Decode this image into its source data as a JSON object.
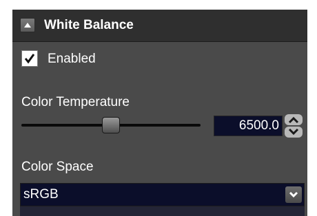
{
  "section": {
    "title": "White Balance",
    "expanded": true
  },
  "enabled": {
    "label": "Enabled",
    "checked": true
  },
  "color_temperature": {
    "label": "Color Temperature",
    "value": "6500.0",
    "slider_fraction": 0.5
  },
  "color_space": {
    "label": "Color Space",
    "selected": "sRGB"
  },
  "colors": {
    "panel_bg": "#4a4a4a",
    "header_bg": "#2f2f2f",
    "input_bg": "#0b0e2a",
    "text": "#ffffff"
  },
  "icons": {
    "collapse": "triangle-up-icon",
    "check": "checkmark-icon",
    "spin_up": "chevron-up-icon",
    "spin_down": "chevron-down-icon",
    "dropdown": "chevron-down-icon"
  }
}
